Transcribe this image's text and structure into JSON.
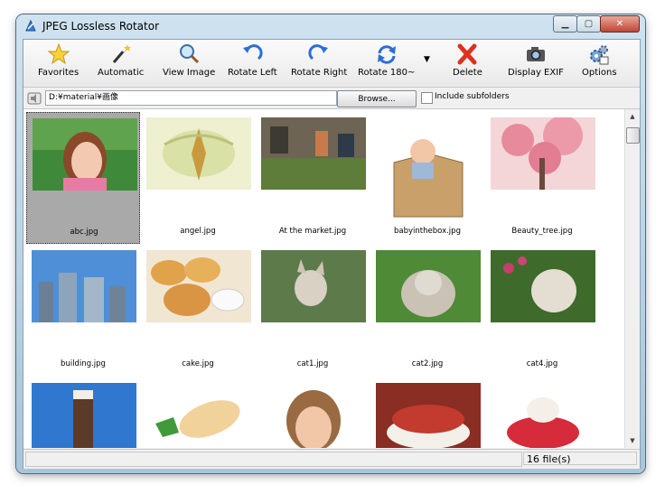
{
  "window": {
    "title": "JPEG Lossless Rotator"
  },
  "toolbar": {
    "buttons": [
      {
        "label": "Favorites",
        "icon": "star-icon"
      },
      {
        "label": "Automatic",
        "icon": "magic-wand-icon"
      },
      {
        "label": "View Image",
        "icon": "magnifier-icon"
      },
      {
        "label": "Rotate Left",
        "icon": "rotate-left-icon"
      },
      {
        "label": "Rotate Right",
        "icon": "rotate-right-icon"
      },
      {
        "label": "Rotate 180~",
        "icon": "rotate-180-icon"
      },
      {
        "label": "Delete",
        "icon": "delete-x-icon"
      },
      {
        "label": "Display EXIF",
        "icon": "camera-icon"
      },
      {
        "label": "Options",
        "icon": "options-gears-icon"
      }
    ]
  },
  "pathbar": {
    "path": "D:¥material¥画像",
    "browse_label": "Browse...",
    "include_subfolders_label": "Include subfolders",
    "include_subfolders_checked": false
  },
  "files": [
    {
      "name": "abc.jpg",
      "selected": true
    },
    {
      "name": "angel.jpg"
    },
    {
      "name": "At the market.jpg"
    },
    {
      "name": "babyinthebox.jpg"
    },
    {
      "name": "Beauty_tree.jpg"
    },
    {
      "name": "building.jpg"
    },
    {
      "name": "cake.jpg"
    },
    {
      "name": "cat1.jpg"
    },
    {
      "name": "cat2.jpg"
    },
    {
      "name": "cat4.jpg"
    },
    {
      "name": ""
    },
    {
      "name": ""
    },
    {
      "name": ""
    },
    {
      "name": ""
    },
    {
      "name": ""
    }
  ],
  "status": {
    "file_count": "16 file(s)"
  },
  "colors": {
    "selection": "#a9a9a9",
    "delete": "#e0301e",
    "rotate": "#2a6fd6"
  }
}
